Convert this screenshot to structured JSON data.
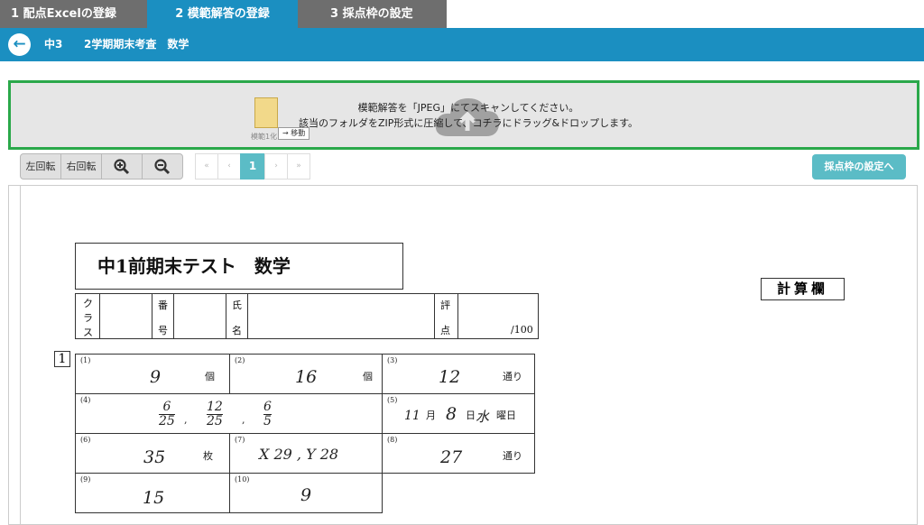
{
  "tabs": [
    {
      "label": "1 配点Excelの登録"
    },
    {
      "label": "2 模範解答の登録"
    },
    {
      "label": "3 採点枠の設定"
    }
  ],
  "header": {
    "back_icon": "arrow-left-icon",
    "class_name": "中3",
    "exam_name": "2学期期末考査　数学"
  },
  "dropzone": {
    "line1": "模範解答を「JPEG」にてスキャンしてください。",
    "line2": "該当のフォルダをZIP形式に圧縮して、コチラにドラッグ&ドロップします。",
    "file_caption": "模範1化",
    "move_label": "→ 移動",
    "icon": "cloud-upload-icon"
  },
  "toolbar": {
    "rotate_left": "左回転",
    "rotate_right": "右回転",
    "zoom_in_icon": "zoom-in-icon",
    "zoom_out_icon": "zoom-out-icon"
  },
  "pager": {
    "first": "«",
    "prev": "‹",
    "current": "1",
    "next": "›",
    "last": "»"
  },
  "next_step_button": "採点枠の設定へ",
  "sheet": {
    "title": "中1前期末テスト　数学",
    "calc_label": "計算欄",
    "info": {
      "class_chars": [
        "ク",
        "ラ",
        "ス"
      ],
      "number_chars": [
        "番",
        "号"
      ],
      "name_chars": [
        "氏",
        "名"
      ],
      "score_chars": [
        "評",
        "点"
      ],
      "score_total": "/100"
    },
    "question_number": "1",
    "answers": [
      {
        "no": "(1)",
        "value": "9",
        "unit": "個"
      },
      {
        "no": "(2)",
        "value": "16",
        "unit": "個"
      },
      {
        "no": "(3)",
        "value": "12",
        "unit": "通り"
      },
      {
        "no": "(4)",
        "fractions": [
          {
            "num": "6",
            "den": "25"
          },
          {
            "num": "12",
            "den": "25"
          },
          {
            "num": "6",
            "den": "5"
          }
        ]
      },
      {
        "no": "(5)",
        "month": "11",
        "month_unit": "月",
        "day": "8",
        "day_unit": "日",
        "weekday": "水",
        "weekday_unit": "曜日"
      },
      {
        "no": "(6)",
        "value": "35",
        "unit": "枚"
      },
      {
        "no": "(7)",
        "value": "X 29 , Y 28"
      },
      {
        "no": "(8)",
        "value": "27",
        "unit": "通り"
      },
      {
        "no": "(9)",
        "value": "15"
      },
      {
        "no": "(10)",
        "value": "9"
      }
    ]
  },
  "colors": {
    "accent": "#1b8fc1",
    "tab_inactive": "#6e6e6e",
    "dropzone_border": "#2aa84a",
    "teal_button": "#5bbcc6"
  }
}
